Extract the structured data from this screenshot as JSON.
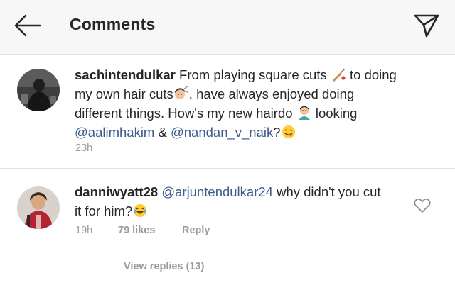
{
  "header": {
    "title": "Comments",
    "back_icon": "arrow-left-icon",
    "send_icon": "paper-plane-icon"
  },
  "caption": {
    "username": "sachintendulkar",
    "text_1": " From playing square cuts ",
    "text_2": " to doing",
    "text_3": "my own hair cuts",
    "text_4": ", have always enjoyed doing",
    "text_5": "different things. How's my new hairdo ",
    "text_6": " looking",
    "mention_1": "@aalimhakim",
    "text_7": " & ",
    "mention_2": "@nandan_v_naik",
    "text_8": "?",
    "time": "23h",
    "emojis": [
      "cricket-bat-icon",
      "haircut-icon",
      "man-gesturing-icon",
      "yum-face-icon"
    ]
  },
  "comment": {
    "username": "danniwyatt28",
    "mention": "@arjuntendulkar24",
    "text_1": " why didn't you cut",
    "text_2": "it for him?",
    "time": "19h",
    "likes": "79 likes",
    "reply_label": "Reply",
    "emojis": [
      "laughing-tears-icon"
    ]
  },
  "replies": {
    "label": "View replies (13)"
  },
  "colors": {
    "mention": "#3c5a8a",
    "meta": "#9a9a9a",
    "header_bg": "#f7f7f7",
    "text": "#262626"
  }
}
